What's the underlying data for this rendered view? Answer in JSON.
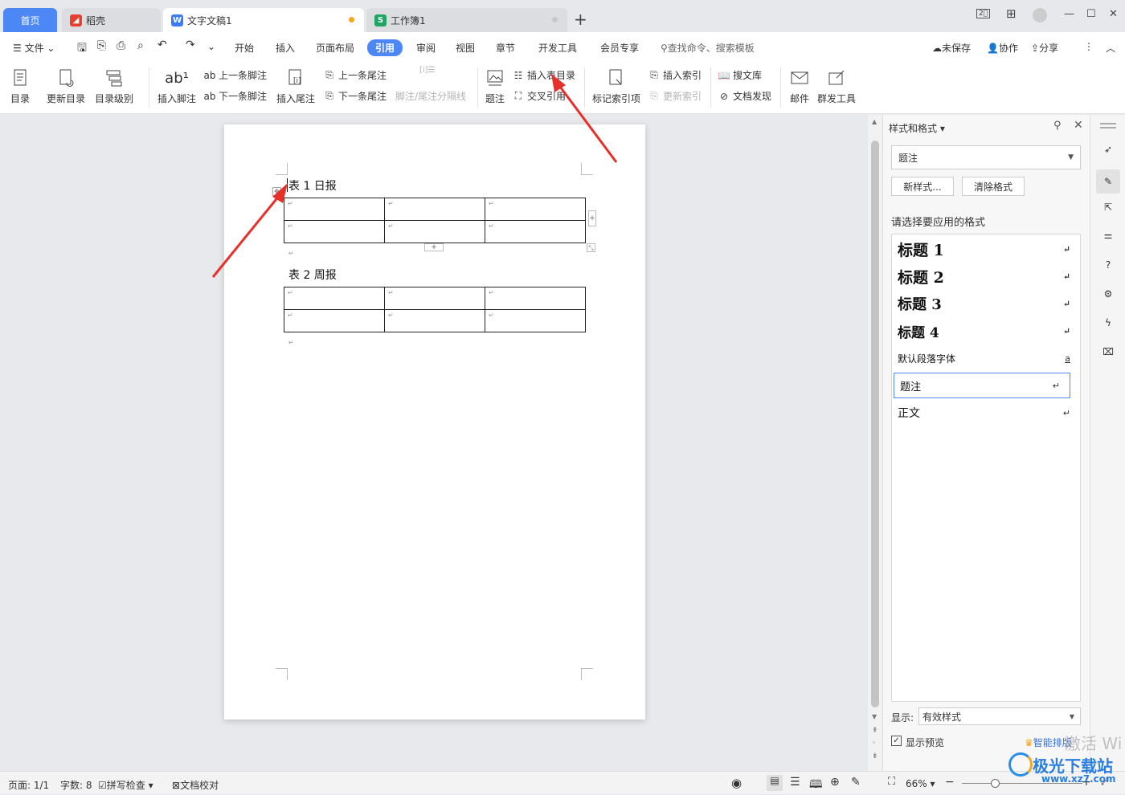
{
  "tabs": {
    "home": "首页",
    "daoke": "稻壳",
    "doc": "文字文稿1",
    "sheet": "工作簿1",
    "new_tab": "+"
  },
  "menu": {
    "file": "文件",
    "items": [
      "开始",
      "插入",
      "页面布局",
      "引用",
      "审阅",
      "视图",
      "章节",
      "开发工具",
      "会员专享"
    ],
    "search_placeholder": "查找命令、搜索模板",
    "unsaved": "未保存",
    "collab": "协作",
    "share": "分享"
  },
  "ribbon": {
    "toc": "目录",
    "update_toc": "更新目录",
    "toc_level": "目录级别",
    "insert_footnote": "插入脚注",
    "prev_footnote": "上一条脚注",
    "next_footnote": "下一条脚注",
    "insert_endnote": "插入尾注",
    "prev_endnote": "上一条尾注",
    "next_endnote": "下一条尾注",
    "separator": "脚注/尾注分隔线",
    "caption": "题注",
    "insert_table_toc": "插入表目录",
    "cross_ref": "交叉引用",
    "mark_index": "标记索引项",
    "insert_index": "插入索引",
    "update_index": "更新索引",
    "search_lib": "搜文库",
    "doc_discover": "文档发现",
    "mail": "邮件",
    "mass_tool": "群发工具"
  },
  "document": {
    "caption1": "表 1 日报",
    "caption2": "表 2 周报"
  },
  "panel": {
    "title": "样式和格式",
    "current_style": "题注",
    "new_style": "新样式...",
    "clear_format": "清除格式",
    "prompt": "请选择要应用的格式",
    "styles": [
      "标题 1",
      "标题 2",
      "标题 3",
      "标题 4",
      "默认段落字体",
      "题注",
      "正文"
    ],
    "show_label": "显示:",
    "show_value": "有效样式",
    "preview": "显示预览",
    "smart": "智能排版"
  },
  "status": {
    "page": "页面: 1/1",
    "words": "字数: 8",
    "spell": "拼写检查",
    "proof": "文档校对",
    "zoom": "66%"
  },
  "watermark": {
    "activate": "激活 Wi",
    "brand": "极光下载站",
    "url": "www.xz7.com"
  },
  "colors": {
    "accent": "#4d87f6",
    "arrow": "#e8302a"
  }
}
